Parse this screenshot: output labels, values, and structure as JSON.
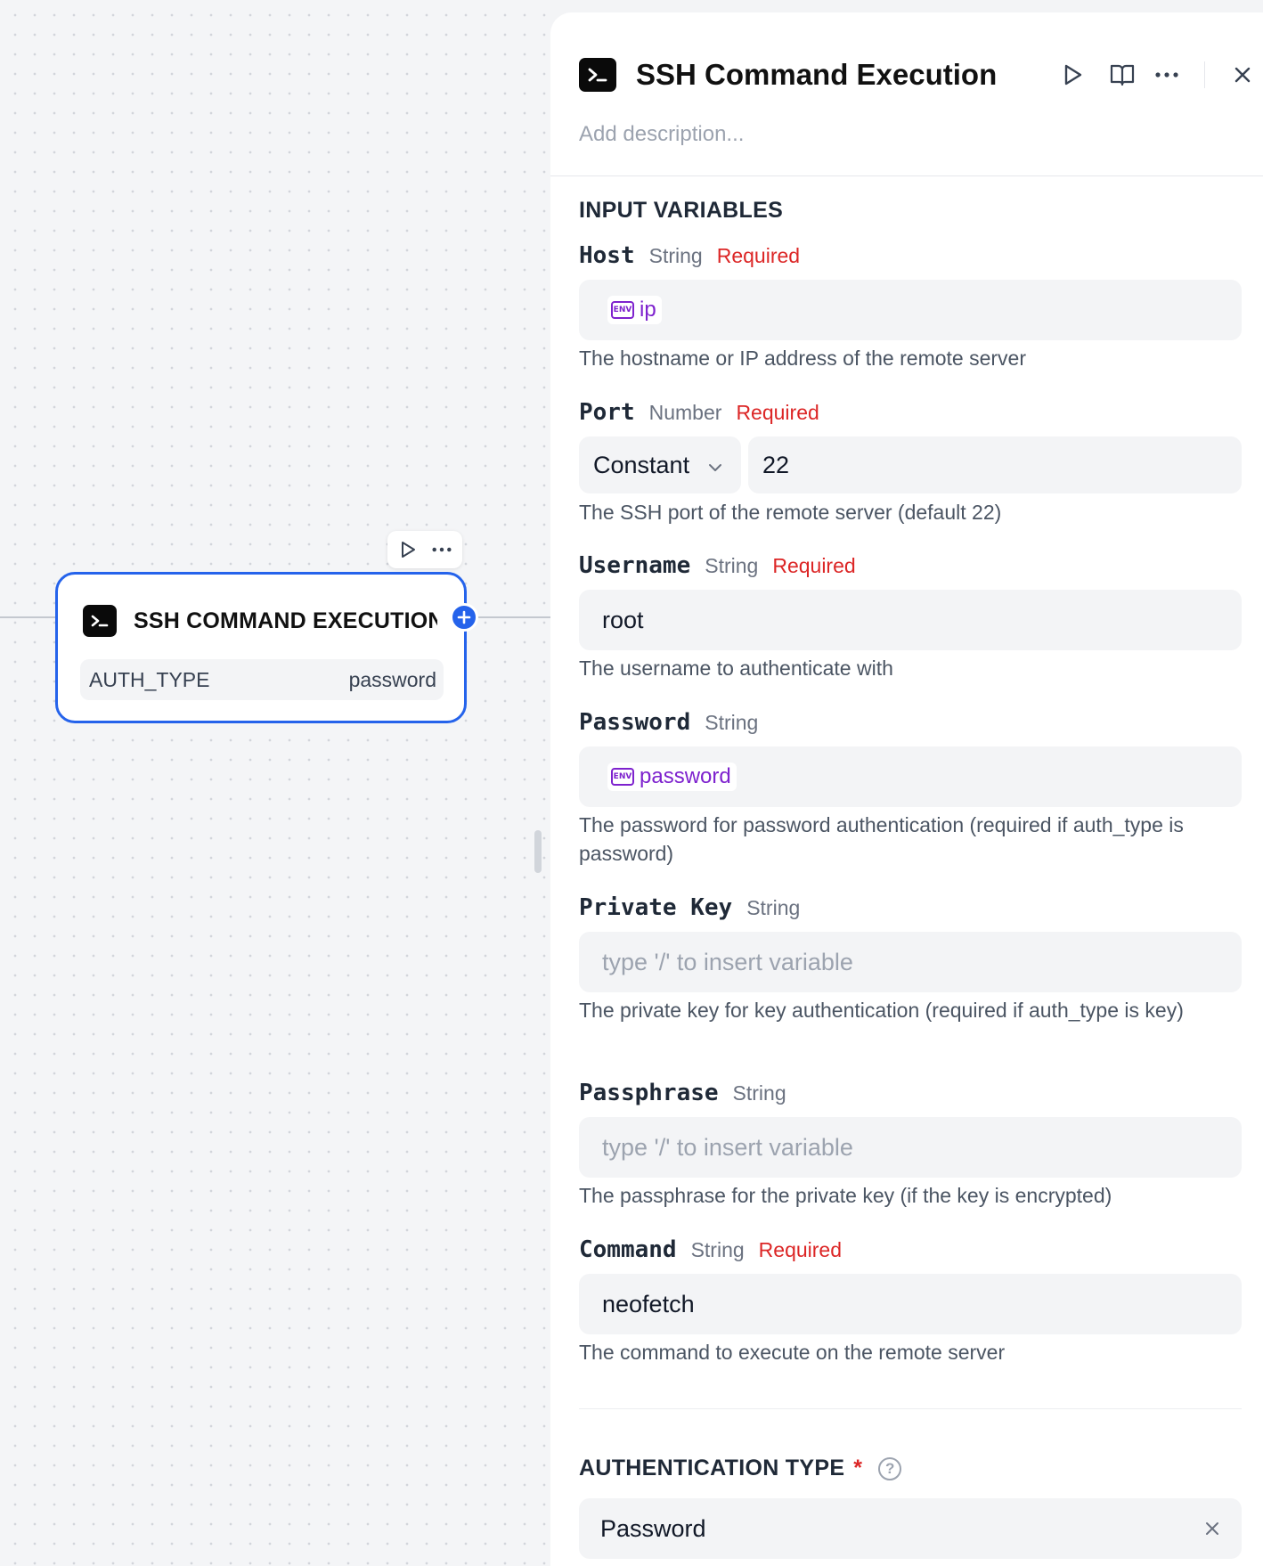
{
  "canvas": {
    "node": {
      "title": "SSH COMMAND EXECUTION",
      "param_key": "AUTH_TYPE",
      "param_value": "password"
    },
    "toolbar": {
      "run_icon": "play-icon",
      "more_icon": "more-dots-icon"
    }
  },
  "panel": {
    "title": "SSH Command Execution",
    "description_placeholder": "Add description...",
    "header_icons": [
      "play-icon",
      "book-icon",
      "more-dots-icon",
      "close-icon"
    ],
    "section_title": "INPUT VARIABLES",
    "fields": {
      "host": {
        "name": "Host",
        "type": "String",
        "required": "Required",
        "env_badge": "ENV",
        "env_value": "ip",
        "help": "The hostname or IP address of the remote server"
      },
      "port": {
        "name": "Port",
        "type": "Number",
        "required": "Required",
        "mode": "Constant",
        "value": "22",
        "help": "The SSH port of the remote server (default 22)"
      },
      "username": {
        "name": "Username",
        "type": "String",
        "required": "Required",
        "value": "root",
        "help": "The username to authenticate with"
      },
      "password": {
        "name": "Password",
        "type": "String",
        "env_badge": "ENV",
        "env_value": "password",
        "help": "The password for password authentication (required if auth_type is password)"
      },
      "private_key": {
        "name": "Private Key",
        "type": "String",
        "placeholder": "type '/' to insert variable",
        "help": "The private key for key authentication (required if auth_type is key)"
      },
      "passphrase": {
        "name": "Passphrase",
        "type": "String",
        "placeholder": "type '/' to insert variable",
        "help": "The passphrase for the private key (if the key is encrypted)"
      },
      "command": {
        "name": "Command",
        "type": "String",
        "required": "Required",
        "value": "neofetch",
        "help": "The command to execute on the remote server"
      }
    },
    "auth": {
      "title": "AUTHENTICATION TYPE",
      "asterisk": "*",
      "help_glyph": "?",
      "value": "Password"
    }
  },
  "colors": {
    "accent": "#2563eb",
    "required": "#dc2626",
    "env": "#7e22ce"
  }
}
